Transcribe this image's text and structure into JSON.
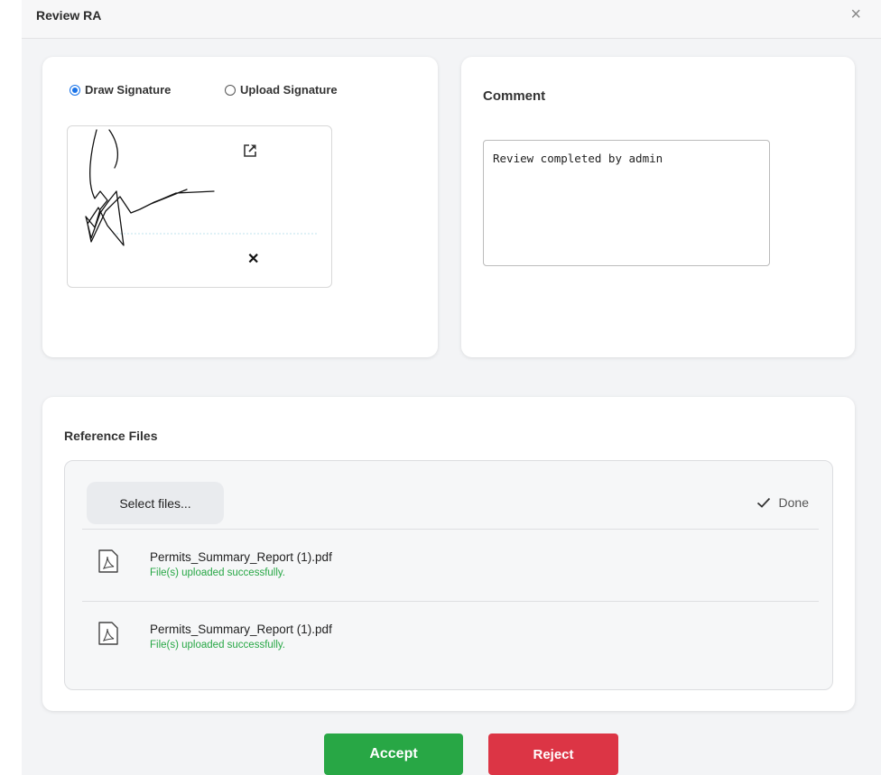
{
  "dialog": {
    "title": "Review RA",
    "close_glyph": "×"
  },
  "signature": {
    "options": [
      {
        "label": "Draw Signature",
        "selected": true
      },
      {
        "label": "Upload Signature",
        "selected": false
      }
    ],
    "expand_icon": "external-link-icon",
    "clear_glyph": "✕"
  },
  "comment": {
    "label": "Comment",
    "value": "Review completed by admin"
  },
  "reference_files": {
    "label": "Reference Files",
    "select_button": "Select files...",
    "status": "Done",
    "files": [
      {
        "name": "Permits_Summary_Report (1).pdf",
        "status": "File(s) uploaded successfully."
      },
      {
        "name": "Permits_Summary_Report (1).pdf",
        "status": "File(s) uploaded successfully."
      }
    ]
  },
  "actions": {
    "accept": "Accept",
    "reject": "Reject"
  },
  "colors": {
    "accept": "#28a745",
    "reject": "#dc3545",
    "success_text": "#27a745",
    "radio_selected": "#1a73e8"
  }
}
